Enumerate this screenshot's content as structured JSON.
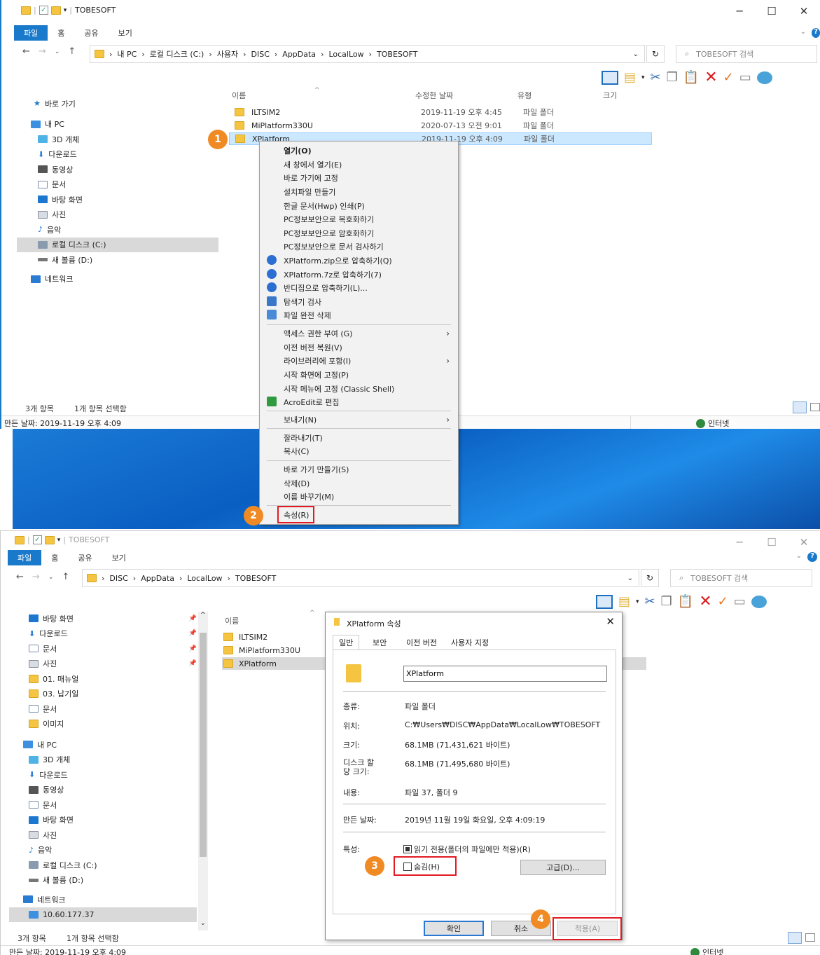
{
  "top": {
    "title": "TOBESOFT",
    "tabs": [
      "파일",
      "홈",
      "공유",
      "보기"
    ],
    "address": [
      "내 PC",
      "로컬 디스크 (C:)",
      "사용자",
      "DISC",
      "AppData",
      "LocalLow",
      "TOBESOFT"
    ],
    "search_placeholder": "TOBESOFT 검색",
    "tree": [
      "바로 가기",
      "내 PC",
      "3D 개체",
      "다운로드",
      "동영상",
      "문서",
      "바탕 화면",
      "사진",
      "음악",
      "로컬 디스크 (C:)",
      "새 볼륨 (D:)",
      "네트워크"
    ],
    "columns": [
      "이름",
      "수정한 날짜",
      "유형",
      "크기"
    ],
    "files": [
      {
        "name": "ILTSIM2",
        "date": "2019-11-19 오후 4:45",
        "type": "파일 폴더"
      },
      {
        "name": "MiPlatform330U",
        "date": "2020-07-13 오전 9:01",
        "type": "파일 폴더"
      },
      {
        "name": "XPlatform",
        "date": "2019-11-19 오후 4:09",
        "type": "파일 폴더"
      }
    ],
    "status_count": "3개 항목",
    "status_selected": "1개 항목 선택함",
    "created": "만든 날짜: 2019-11-19 오후 4:09",
    "internet": "인터넷"
  },
  "menu": {
    "items": [
      "열기(O)",
      "새 창에서 열기(E)",
      "바로 가기에 고정",
      "설치파일 만들기",
      "한글 문서(Hwp) 인쇄(P)",
      "PC정보보안으로 복호화하기",
      "PC정보보안으로 암호화하기",
      "PC정보보안으로 문서 검사하기",
      "XPlatform.zip으로 압축하기(Q)",
      "XPlatform.7z로 압축하기(7)",
      "반디집으로 압축하기(L)...",
      "탐색기 검사",
      "파일 완전 삭제",
      "액세스 권한 부여 (G)",
      "이전 버전 복원(V)",
      "라이브러리에 포함(I)",
      "시작 화면에 고정(P)",
      "시작 메뉴에 고정 (Classic Shell)",
      "AcroEdit로 편집",
      "보내기(N)",
      "잘라내기(T)",
      "복사(C)",
      "바로 가기 만들기(S)",
      "삭제(D)",
      "이름 바꾸기(M)",
      "속성(R)"
    ]
  },
  "badges": [
    "1",
    "2",
    "3",
    "4"
  ],
  "bottom": {
    "title": "TOBESOFT",
    "tabs": [
      "파일",
      "홈",
      "공유",
      "보기"
    ],
    "address": [
      "DISC",
      "AppData",
      "LocalLow",
      "TOBESOFT"
    ],
    "search_placeholder": "TOBESOFT 검색",
    "tree": [
      "바탕 화면",
      "다운로드",
      "문서",
      "사진",
      "01. 매뉴얼",
      "03. 납기일",
      "문서",
      "이미지",
      "내 PC",
      "3D 개체",
      "다운로드",
      "동영상",
      "문서",
      "바탕 화면",
      "사진",
      "음악",
      "로컬 디스크 (C:)",
      "새 볼륨 (D:)",
      "네트워크",
      "10.60.177.37"
    ],
    "col_name": "이름",
    "files": [
      "ILTSIM2",
      "MiPlatform330U",
      "XPlatform"
    ],
    "status_count": "3개 항목",
    "status_selected": "1개 항목 선택함",
    "created": "만든 날짜: 2019-11-19 오후 4:09",
    "internet": "인터넷"
  },
  "dialog": {
    "title": "XPlatform 속성",
    "tabs": [
      "일반",
      "보안",
      "이전 버전",
      "사용자 지정"
    ],
    "name": "XPlatform",
    "rows": [
      {
        "label": "종류:",
        "value": "파일 폴더"
      },
      {
        "label": "위치:",
        "value": "C:₩Users₩DISC₩AppData₩LocalLow₩TOBESOFT"
      },
      {
        "label": "크기:",
        "value": "68.1MB (71,431,621 바이트)"
      },
      {
        "label": "디스크 할\n당 크기:",
        "value": "68.1MB (71,495,680 바이트)"
      },
      {
        "label": "내용:",
        "value": "파일 37, 폴더 9"
      },
      {
        "label": "만든 날짜:",
        "value": "2019년 11월 19일 화요일, 오후 4:09:19"
      }
    ],
    "attr_label": "특성:",
    "readonly": "읽기 전용(폴더의 파일에만 적용)(R)",
    "hidden": "숨김(H)",
    "advanced": "고급(D)...",
    "ok": "확인",
    "cancel": "취소",
    "apply": "적용(A)"
  }
}
